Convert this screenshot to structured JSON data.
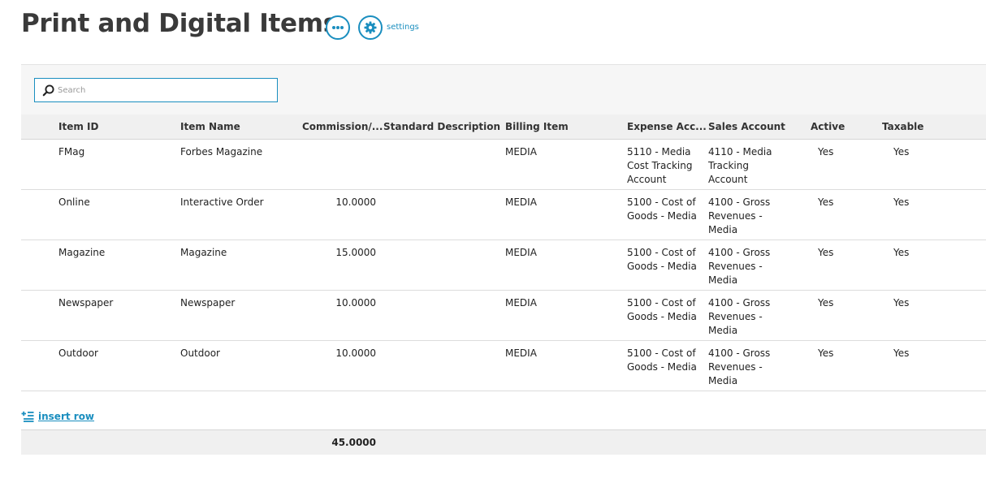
{
  "page": {
    "title": "Print and Digital Items"
  },
  "toolbar": {
    "settings_label": "settings"
  },
  "search": {
    "placeholder": "Search",
    "value": ""
  },
  "table": {
    "headers": {
      "item_id": "Item ID",
      "item_name": "Item Name",
      "commission": "Commission/...",
      "standard_description": "Standard Description",
      "billing_item": "Billing Item",
      "expense_account": "Expense Acc...",
      "sales_account": "Sales Account",
      "active": "Active",
      "taxable": "Taxable"
    },
    "rows": [
      {
        "item_id": "FMag",
        "item_name": "Forbes Magazine",
        "commission": "",
        "standard_description": "",
        "billing_item": "MEDIA",
        "expense_account": "5110 - Media Cost Tracking Account",
        "sales_account": "4110 - Media Tracking Account",
        "active": "Yes",
        "taxable": "Yes"
      },
      {
        "item_id": "Online",
        "item_name": "Interactive Order",
        "commission": "10.0000",
        "standard_description": "",
        "billing_item": "MEDIA",
        "expense_account": "5100 - Cost of Goods - Media",
        "sales_account": "4100 - Gross Revenues - Media",
        "active": "Yes",
        "taxable": "Yes"
      },
      {
        "item_id": "Magazine",
        "item_name": "Magazine",
        "commission": "15.0000",
        "standard_description": "",
        "billing_item": "MEDIA",
        "expense_account": "5100 - Cost of Goods - Media",
        "sales_account": "4100 - Gross Revenues - Media",
        "active": "Yes",
        "taxable": "Yes"
      },
      {
        "item_id": "Newspaper",
        "item_name": "Newspaper",
        "commission": "10.0000",
        "standard_description": "",
        "billing_item": "MEDIA",
        "expense_account": "5100 - Cost of Goods - Media",
        "sales_account": "4100 - Gross Revenues - Media",
        "active": "Yes",
        "taxable": "Yes"
      },
      {
        "item_id": "Outdoor",
        "item_name": "Outdoor",
        "commission": "10.0000",
        "standard_description": "",
        "billing_item": "MEDIA",
        "expense_account": "5100 - Cost of Goods - Media",
        "sales_account": "4100 - Gross Revenues - Media",
        "active": "Yes",
        "taxable": "Yes"
      }
    ],
    "insert_row_label": "insert row",
    "totals": {
      "commission": "45.0000"
    }
  },
  "icons": {
    "more": "more-icon",
    "settings": "gear-icon",
    "search": "search-icon",
    "insert": "insert-row-icon"
  },
  "colors": {
    "accent": "#1a8ebf",
    "header_bg": "#f0f0f0",
    "panel_bg": "#f6f6f6"
  }
}
